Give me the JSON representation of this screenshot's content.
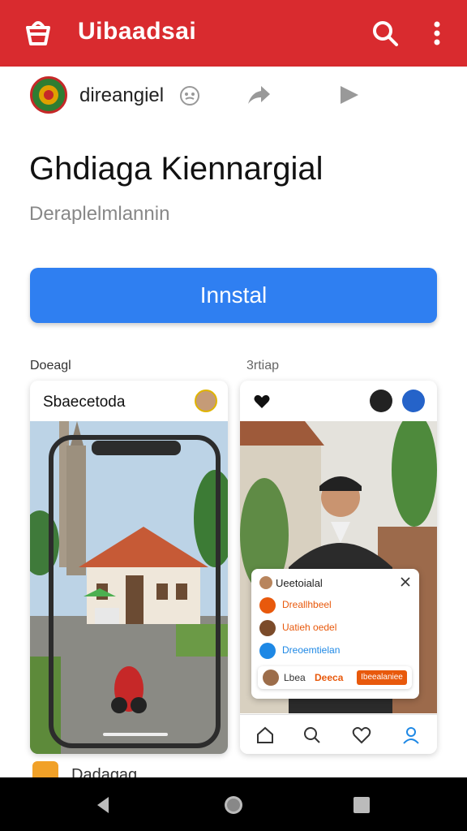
{
  "header": {
    "title": "Uibaadsai",
    "logo_icon": "store-bag-icon",
    "search_icon": "search-icon",
    "menu_icon": "more-vert-icon",
    "color": "#d92b2f"
  },
  "subheader": {
    "account_name": "direangiel",
    "icons": [
      "emoji-icon",
      "share-icon",
      "play-icon"
    ]
  },
  "app": {
    "title": "Ghdiaga Kiennargial",
    "developer": "Deraplelmlannin",
    "install_label": "Innstal",
    "accent": "#2f7ff1"
  },
  "screenshots": {
    "label_left": "Doeagl",
    "label_right": "3rtiap",
    "card1": {
      "title": "Sbaecetoda"
    },
    "card2": {
      "popup": {
        "title": "Ueetoialal",
        "items": [
          {
            "text": "Dreallhbeel",
            "color": "#e8590c"
          },
          {
            "text": "Uatieh oedel",
            "color": "#e8590c"
          },
          {
            "text": "Dreoemtielan",
            "color": "#1e88e5"
          }
        ],
        "row4": {
          "left": "Lbea",
          "mid": "Deeca",
          "tag": "Ibeealaniee"
        }
      },
      "tab_icons": [
        "home-icon",
        "search-icon",
        "heart-icon",
        "profile-icon"
      ]
    }
  },
  "peek": {
    "text": "Dadagag"
  },
  "navigation": {
    "buttons": [
      "back-icon",
      "home-circle-icon",
      "recents-icon"
    ]
  }
}
